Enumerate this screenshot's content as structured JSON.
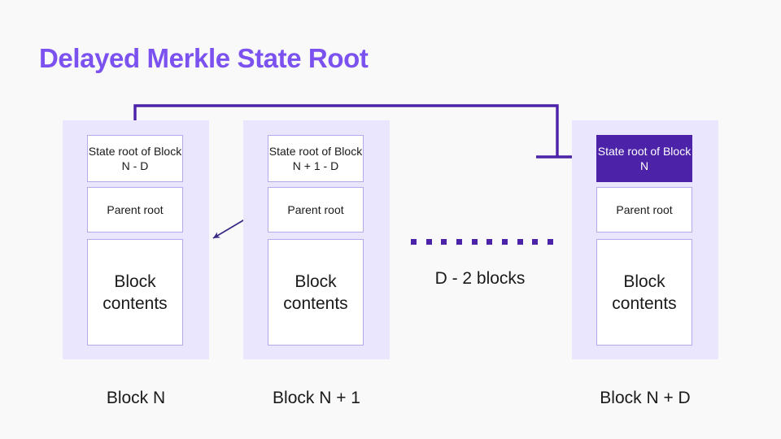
{
  "page": {
    "title": "Delayed Merkle State Root",
    "background_color": "#F9F9F9",
    "accent_color": "#7B52F0",
    "highlight_color": "#4B22A8",
    "panel_color": "#E9E6FD",
    "box_border_color": "#B5A8E8"
  },
  "columns": [
    {
      "id": "block-n",
      "caption": "Block N",
      "cells": {
        "state_root": "State root of Block N - D",
        "parent_root": "Parent root",
        "contents": "Block contents"
      },
      "highlighted": false
    },
    {
      "id": "block-n-plus-1",
      "caption": "Block N + 1",
      "cells": {
        "state_root": "State root of Block N + 1 - D",
        "parent_root": "Parent root",
        "contents": "Block contents"
      },
      "highlighted": false
    },
    {
      "id": "block-n-plus-d",
      "caption": "Block N + D",
      "cells": {
        "state_root": "State root of Block N",
        "parent_root": "Parent root",
        "contents": "Block contents"
      },
      "highlighted": true
    }
  ],
  "gap": {
    "label": "D - 2 blocks",
    "dot_count": 10,
    "dot_color": "#4B22A8"
  },
  "arrows": {
    "delayed_state_root": {
      "name": "state-root-delay-arrow",
      "from": "State root of Block N (Block N + D)",
      "to": "State root of Block N - D (Block N)",
      "color": "#4B22A8"
    },
    "parent_link": {
      "name": "parent-root-link-arrow",
      "from": "Parent root (Block N + 1)",
      "to": "Block N",
      "color": "#4B22A8"
    }
  }
}
